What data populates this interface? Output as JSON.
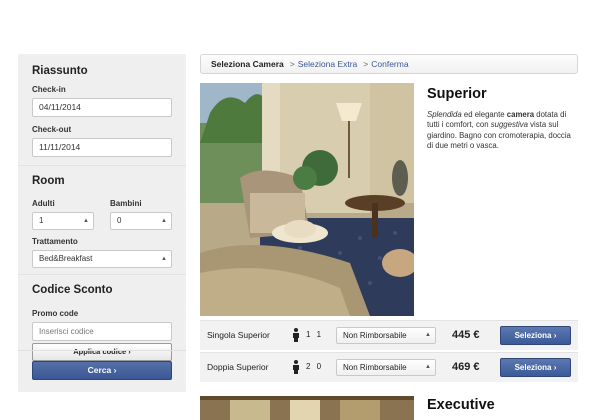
{
  "sidebar": {
    "summary_heading": "Riassunto",
    "checkin_label": "Check-in",
    "checkin_value": "04/11/2014",
    "checkout_label": "Check-out",
    "checkout_value": "11/11/2014",
    "room_heading": "Room",
    "adults_label": "Adulti",
    "adults_value": "1",
    "children_label": "Bambini",
    "children_value": "0",
    "treatment_label": "Trattamento",
    "treatment_value": "Bed&Breakfast",
    "discount_heading": "Codice Sconto",
    "promo_label": "Promo code",
    "promo_placeholder": "Inserisci codice",
    "apply_label": "Applica codice ›",
    "search_label": "Cerca ›"
  },
  "breadcrumb": {
    "step1": "Seleziona Camera",
    "sep": ">",
    "step2": "Seleziona Extra",
    "step3": "Conferma"
  },
  "rooms": [
    {
      "title": "Superior",
      "desc_italic1": "Splendida",
      "desc_text1": " ed elegante ",
      "desc_bold": "camera",
      "desc_text2": " dotata di tutti i comfort, con ",
      "desc_italic2": "suggestiva",
      "desc_text3": " vista sul giardino. Bagno con cromoterapia, doccia di due metri o vasca.",
      "rates": [
        {
          "name": "Singola Superior",
          "occupancy": "1 1",
          "policy": "Non Rimborsabile",
          "price": "445 €",
          "button": "Seleziona ›"
        },
        {
          "name": "Doppia Superior",
          "occupancy": "2 0",
          "policy": "Non Rimborsabile",
          "price": "469 €",
          "button": "Seleziona ›"
        }
      ]
    },
    {
      "title": "Executive"
    }
  ],
  "colors": {
    "accent": "#3b5896",
    "sidebar_bg": "#efefef",
    "row_bg": "#f2f2f2"
  },
  "icons": {
    "person": "person-icon",
    "chevron": "chevron-updown-icon"
  }
}
